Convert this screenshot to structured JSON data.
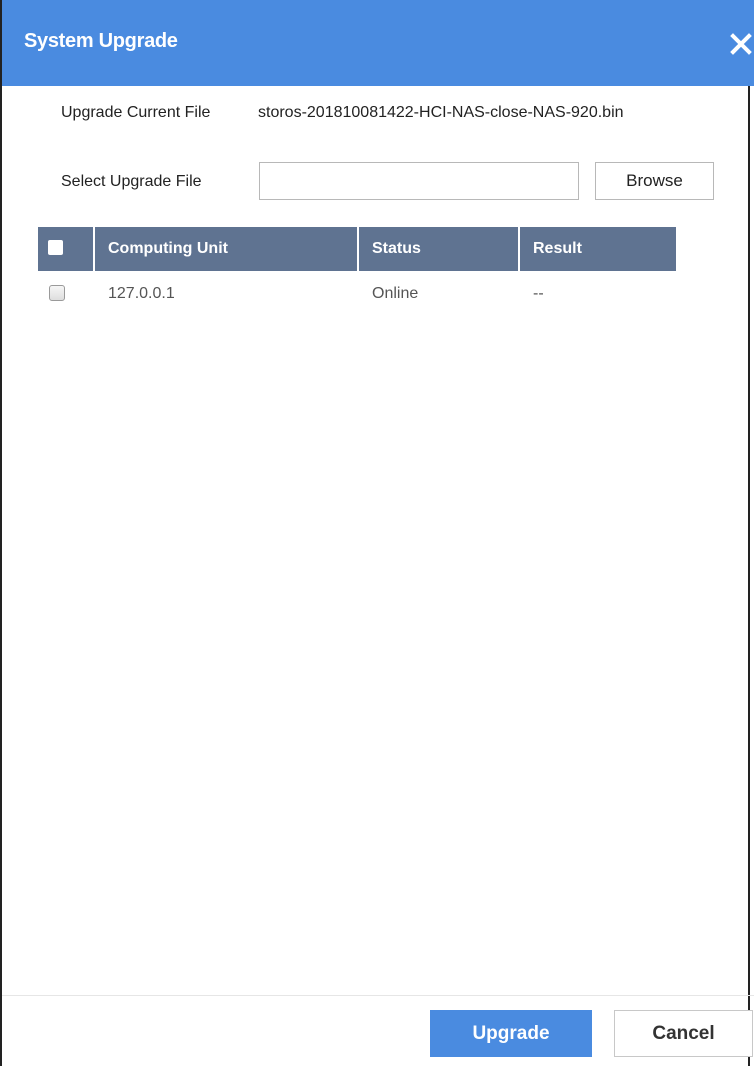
{
  "dialog": {
    "title": "System Upgrade",
    "close_icon": "close-icon",
    "accent_color": "#4a8be0"
  },
  "form": {
    "current_file_label": "Upgrade Current File",
    "current_file_value": "storos-201810081422-HCI-NAS-close-NAS-920.bin",
    "select_file_label": "Select Upgrade File",
    "select_file_value": "",
    "browse_label": "Browse"
  },
  "table": {
    "header_color": "#5f7391",
    "columns": [
      "Computing Unit",
      "Status",
      "Result"
    ],
    "rows": [
      {
        "computing_unit": "127.0.0.1",
        "status": "Online",
        "result": "--",
        "checked": false
      }
    ],
    "select_all_checked": false
  },
  "footer": {
    "upgrade_label": "Upgrade",
    "cancel_label": "Cancel"
  }
}
